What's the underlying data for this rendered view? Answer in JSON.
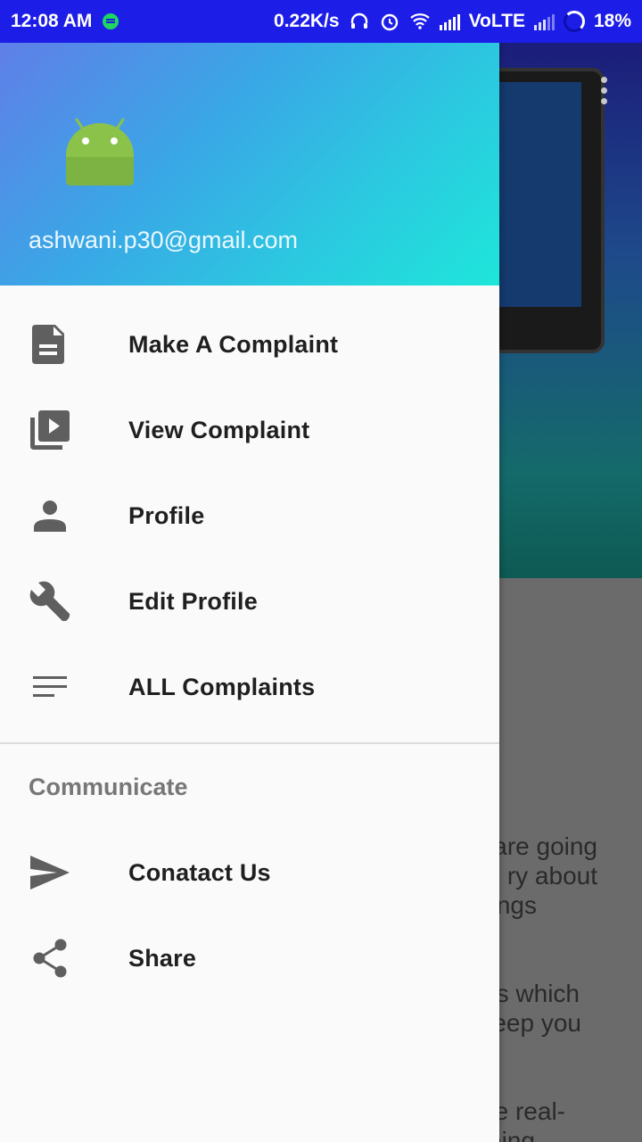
{
  "status_bar": {
    "time": "12:08 AM",
    "network_speed": "0.22K/s",
    "network_type": "VoLTE",
    "battery": "18%",
    "icons": [
      "spotify-icon",
      "headphones-icon",
      "alarm-icon",
      "wifi-icon",
      "signal-icon",
      "signal-icon",
      "battery-icon"
    ]
  },
  "drawer": {
    "header": {
      "email": "ashwani.p30@gmail.com",
      "avatar_icon": "android-icon"
    },
    "items": [
      {
        "label": "Make A Complaint",
        "icon": "document-icon"
      },
      {
        "label": "View Complaint",
        "icon": "video-library-icon"
      },
      {
        "label": "Profile",
        "icon": "person-icon"
      },
      {
        "label": "Edit Profile",
        "icon": "wrench-icon"
      },
      {
        "label": "ALL Complaints",
        "icon": "lines-icon"
      }
    ],
    "section_title": "Communicate",
    "section_items": [
      {
        "label": "Conatact Us",
        "icon": "send-icon"
      },
      {
        "label": "Share",
        "icon": "share-icon"
      }
    ]
  },
  "background_text": {
    "line1": "o are going",
    "line2": "ry about",
    "line3": "hings",
    "line4": "gs which",
    "line5": "keep you",
    "line6": "the real-",
    "line7": "going"
  },
  "colors": {
    "status_bar": "#1d1de8",
    "header_start": "#5f7fe8",
    "header_end": "#1ee6da",
    "android_green": "#8bc34a"
  }
}
